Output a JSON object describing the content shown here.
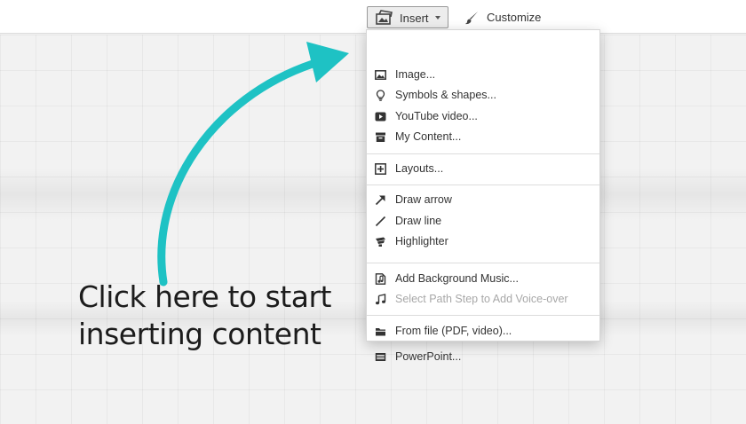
{
  "toolbar": {
    "insert_label": "Insert",
    "customize_label": "Customize"
  },
  "menu": {
    "groups": [
      [
        {
          "label": "Image...",
          "icon": "image-icon"
        },
        {
          "label": "Symbols & shapes...",
          "icon": "lightbulb-icon"
        },
        {
          "label": "YouTube video...",
          "icon": "play-icon"
        },
        {
          "label": "My Content...",
          "icon": "archive-icon"
        }
      ],
      [
        {
          "label": "Layouts...",
          "icon": "layout-plus-icon"
        }
      ],
      [
        {
          "label": "Draw arrow",
          "icon": "arrow-icon"
        },
        {
          "label": "Draw line",
          "icon": "line-icon"
        },
        {
          "label": "Highlighter",
          "icon": "highlighter-icon"
        }
      ],
      [
        {
          "label": "Add Background Music...",
          "icon": "music-file-icon"
        },
        {
          "label": "Select Path Step to Add Voice-over",
          "icon": "music-note-icon",
          "disabled": true
        }
      ],
      [
        {
          "label": "From file (PDF, video)...",
          "icon": "folder-icon"
        },
        {
          "label": "PowerPoint...",
          "icon": "powerpoint-icon"
        }
      ]
    ]
  },
  "callout": {
    "line1": "Click here to start",
    "line2": "inserting content"
  },
  "colors": {
    "arrow": "#1ec2c4",
    "menu_text": "#333333",
    "disabled_text": "#a8a8a8"
  }
}
